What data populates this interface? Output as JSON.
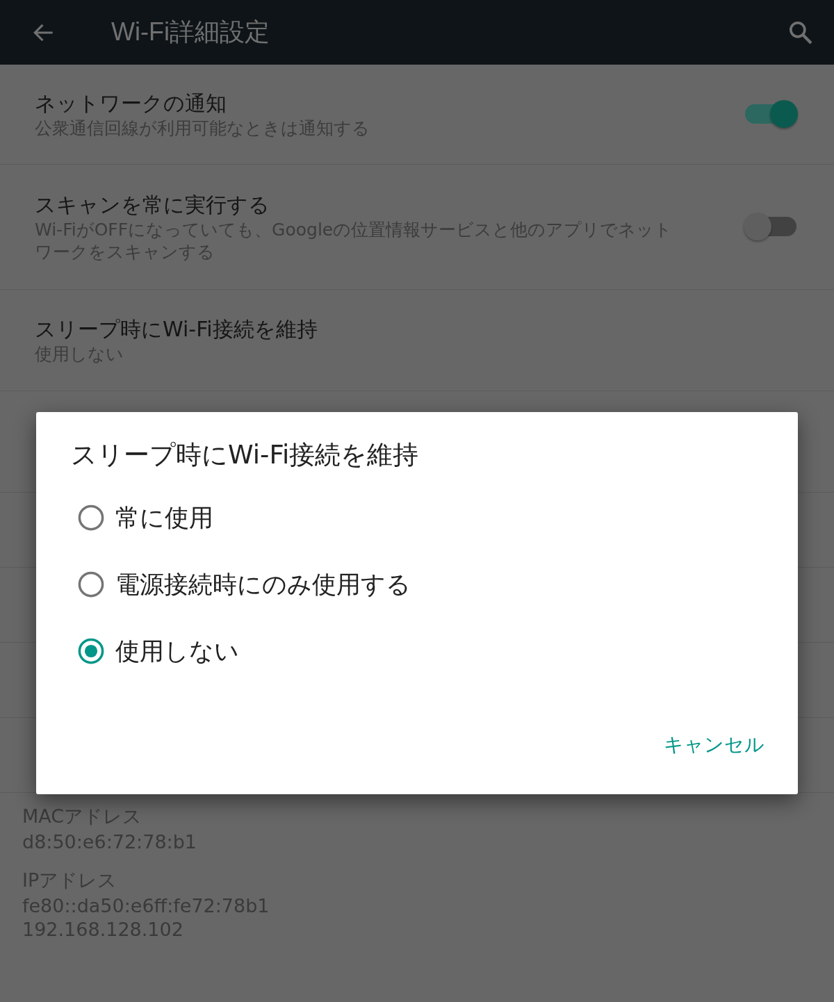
{
  "app_bar": {
    "title": "Wi-Fi詳細設定"
  },
  "settings": [
    {
      "kind": "switch",
      "title": "ネットワークの通知",
      "summary": "公衆通信回線が利用可能なときは通知する",
      "on": true
    },
    {
      "kind": "switch",
      "title": "スキャンを常に実行する",
      "summary": "Wi-FiがOFFになっていても、Googleの位置情報サービスと他のアプリでネットワークをスキャンする",
      "on": false
    },
    {
      "kind": "text",
      "title": "スリープ時にWi-Fi接続を維持",
      "summary": "使用しない"
    }
  ],
  "info": [
    {
      "label": "MACアドレス",
      "values": [
        "d8:50:e6:72:78:b1"
      ]
    },
    {
      "label": "IPアドレス",
      "values": [
        "fe80::da50:e6ff:fe72:78b1",
        "192.168.128.102"
      ]
    }
  ],
  "dialog": {
    "title": "スリープ時にWi-Fi接続を維持",
    "options": [
      {
        "label": "常に使用",
        "selected": false
      },
      {
        "label": "電源接続時にのみ使用する",
        "selected": false
      },
      {
        "label": "使用しない",
        "selected": true
      }
    ],
    "buttons": [
      "キャンセル"
    ]
  }
}
